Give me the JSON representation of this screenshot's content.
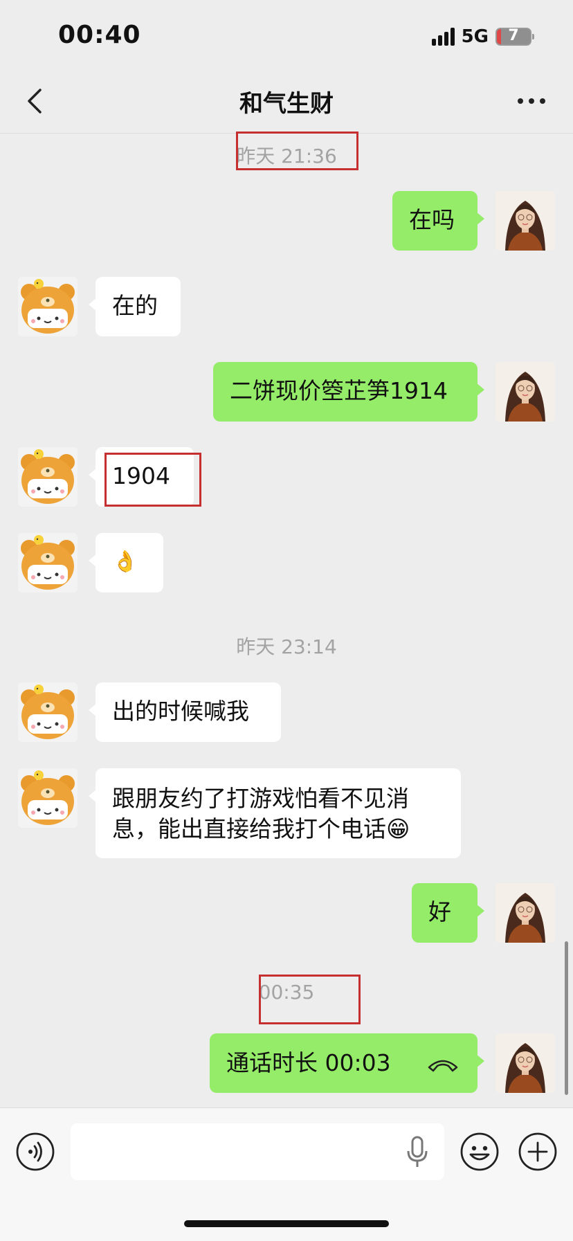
{
  "status_bar": {
    "time": "00:40",
    "network": "5G",
    "battery": "7"
  },
  "header": {
    "title": "和气生财"
  },
  "messages": {
    "ts1": "昨天 21:36",
    "m1": "在吗",
    "m2": "在的",
    "m3": "二饼现价箜芷笋1914",
    "m4": "1904",
    "m5": "👌",
    "ts2": "昨天 23:14",
    "m6": "出的时候喊我",
    "m7_line1": "跟朋友约了打游戏怕看不见消",
    "m7_line2": "息，能出直接给我打个电话",
    "m7_emoji": "😁",
    "m8": "好",
    "ts3": "00:35",
    "call_label": "通话时长 00:03"
  },
  "colors": {
    "sent_bubble": "#95ec69",
    "received_bubble": "#ffffff",
    "highlight_box": "#c62f2f",
    "background": "#ededed"
  },
  "icons": [
    "signal-icon",
    "battery-icon",
    "back-arrow-icon",
    "more-dots-icon",
    "bear-avatar",
    "woman-avatar",
    "phone-hangup-icon",
    "voice-icon",
    "mic-icon",
    "emoji-icon",
    "plus-icon"
  ]
}
